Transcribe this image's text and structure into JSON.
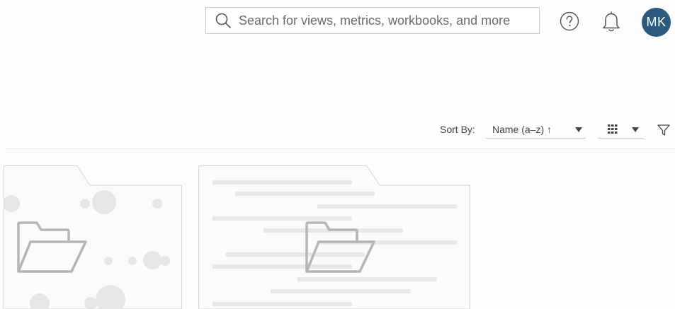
{
  "header": {
    "search": {
      "placeholder": "Search for views, metrics, workbooks, and more",
      "value": ""
    },
    "help_icon": "question-circle-icon",
    "notifications_icon": "bell-icon",
    "avatar": {
      "initials": "MK",
      "color": "#2a5a7e"
    }
  },
  "toolbar": {
    "sort_label": "Sort By:",
    "sort_value": "Name (a–z) ↑",
    "view_icon": "grid-icon",
    "filter_icon": "filter-icon"
  },
  "cards": [
    {
      "thumbnail": "folder-thumbnail-dots",
      "icon": "folder-icon"
    },
    {
      "thumbnail": "folder-thumbnail-lines",
      "icon": "folder-icon"
    }
  ],
  "colors": {
    "avatar_bg": "#2a5a7e",
    "border": "#c9c9c9",
    "thumbnail_fill": "#e8e8e8",
    "folder_stroke": "#b5b5b5"
  }
}
